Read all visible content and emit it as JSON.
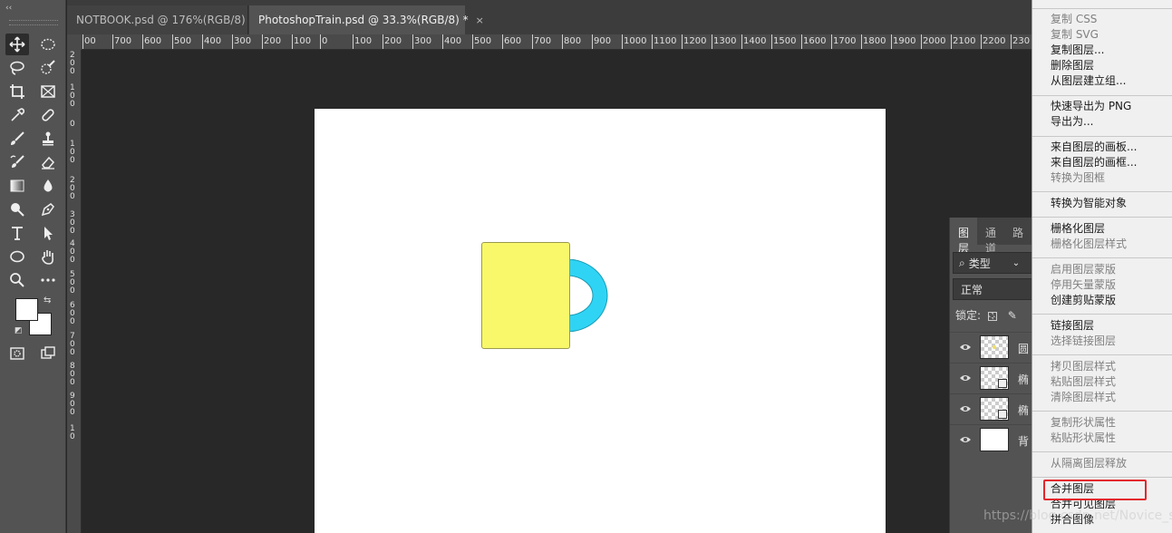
{
  "tabs": [
    {
      "label": "NOTBOOK.psd @ 176%(RGB/8)",
      "close": "×"
    },
    {
      "label": "PhotoshopTrain.psd @ 33.3%(RGB/8) *",
      "close": "×"
    }
  ],
  "toolbar": {
    "collapse": "‹‹",
    "swap": "⇆",
    "reset": "◩"
  },
  "ruler_top": [
    "00",
    "700",
    "600",
    "500",
    "400",
    "300",
    "200",
    "100",
    "0",
    "100",
    "200",
    "300",
    "400",
    "500",
    "600",
    "700",
    "800",
    "900",
    "1000",
    "1100",
    "1200",
    "1300",
    "1400",
    "1500",
    "1600",
    "1700",
    "1800",
    "1900",
    "2000",
    "2100",
    "2200",
    "230"
  ],
  "ruler_left": [
    "2 0 0",
    "1 0 0",
    "0",
    "1 0 0",
    "2 0 0",
    "3 0 0",
    "4 0 0",
    "5 0 0",
    "6 0 0",
    "7 0 0",
    "8 0 0",
    "9 0 0",
    "1 0"
  ],
  "layers_panel": {
    "tabs": [
      "图层",
      "通道",
      "路"
    ],
    "filter_label": "类型",
    "blend_mode": "正常",
    "lock_label": "锁定:",
    "layers": [
      {
        "name": "圆"
      },
      {
        "name": "椭"
      },
      {
        "name": "椭"
      },
      {
        "name": "背"
      }
    ]
  },
  "context_menu": {
    "items": [
      {
        "label": "复制 CSS",
        "enabled": false
      },
      {
        "label": "复制 SVG",
        "enabled": false
      },
      {
        "label": "复制图层...",
        "enabled": true
      },
      {
        "label": "删除图层",
        "enabled": true
      },
      {
        "label": "从图层建立组...",
        "enabled": true
      },
      {
        "label": "快速导出为 PNG",
        "enabled": true
      },
      {
        "label": "导出为...",
        "enabled": true
      },
      {
        "label": "来自图层的画板...",
        "enabled": true
      },
      {
        "label": "来自图层的画框...",
        "enabled": true
      },
      {
        "label": "转换为图框",
        "enabled": false
      },
      {
        "label": "转换为智能对象",
        "enabled": true
      },
      {
        "label": "栅格化图层",
        "enabled": true
      },
      {
        "label": "栅格化图层样式",
        "enabled": false
      },
      {
        "label": "启用图层蒙版",
        "enabled": false
      },
      {
        "label": "停用矢量蒙版",
        "enabled": false
      },
      {
        "label": "创建剪贴蒙版",
        "enabled": true
      },
      {
        "label": "链接图层",
        "enabled": true
      },
      {
        "label": "选择链接图层",
        "enabled": false
      },
      {
        "label": "拷贝图层样式",
        "enabled": false
      },
      {
        "label": "粘贴图层样式",
        "enabled": false
      },
      {
        "label": "清除图层样式",
        "enabled": false
      },
      {
        "label": "复制形状属性",
        "enabled": false
      },
      {
        "label": "粘贴形状属性",
        "enabled": false
      },
      {
        "label": "从隔离图层释放",
        "enabled": false
      },
      {
        "label": "合并图层",
        "enabled": true
      },
      {
        "label": "合并可见图层",
        "enabled": true
      },
      {
        "label": "拼合图像",
        "enabled": true
      }
    ]
  },
  "watermark": "https://blog.csdn.net/Novice_sljg",
  "colors": {
    "mug_body": "#f8f86a",
    "mug_handle": "#2fd4f5",
    "highlight": "#e3262d"
  }
}
